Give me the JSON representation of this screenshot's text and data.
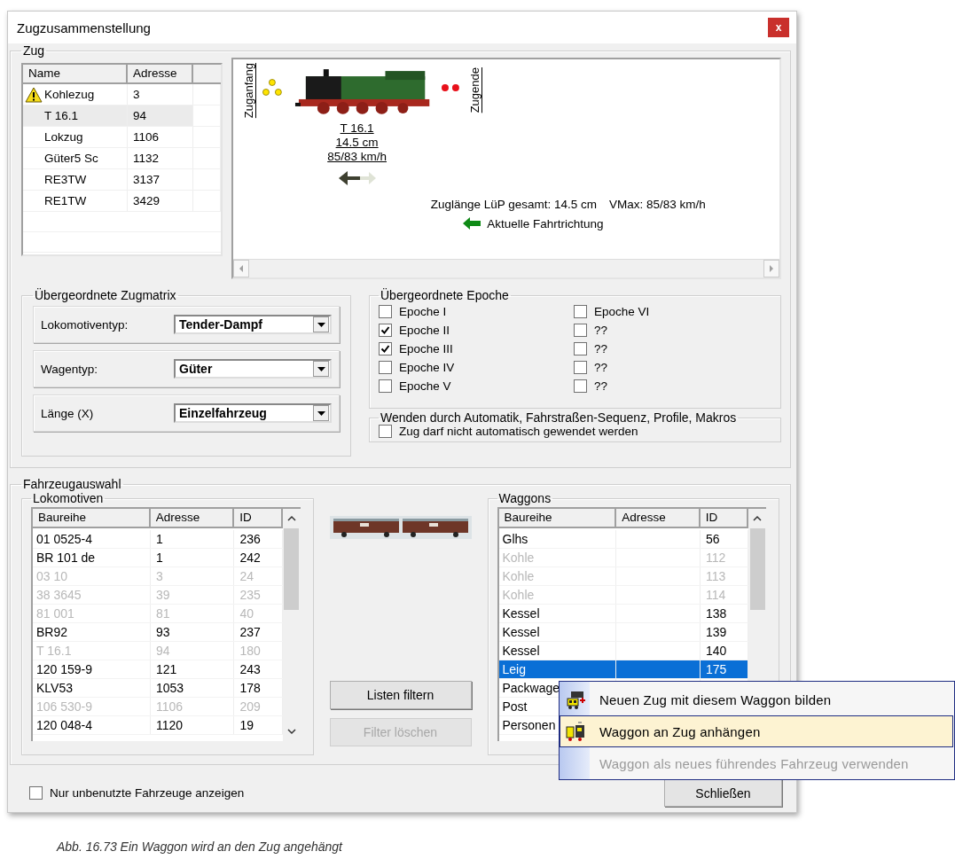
{
  "window": {
    "title": "Zugzusammenstellung",
    "close_label": "x"
  },
  "train": {
    "label": "Zug",
    "columns": [
      "Name",
      "Adresse"
    ],
    "rows": [
      {
        "name": "Kohlezug",
        "address": "3",
        "warning": true,
        "selected": false
      },
      {
        "name": "T 16.1",
        "address": "94",
        "warning": false,
        "selected": true
      },
      {
        "name": "Lokzug",
        "address": "1106",
        "warning": false,
        "selected": false
      },
      {
        "name": "Güter5 Sc",
        "address": "1132",
        "warning": false,
        "selected": false
      },
      {
        "name": "RE3TW",
        "address": "3137",
        "warning": false,
        "selected": false
      },
      {
        "name": "RE1TW",
        "address": "3429",
        "warning": false,
        "selected": false
      }
    ]
  },
  "preview": {
    "start_label": "Zuganfang",
    "end_label": "Zugende",
    "vehicle": {
      "name": "T 16.1",
      "length": "14.5 cm",
      "speed": "85/83 km/h"
    },
    "summary_length": "Zuglänge LüP gesamt: 14.5 cm",
    "summary_speed": "VMax: 85/83 km/h",
    "direction_label": "Aktuelle Fahrtrichtung"
  },
  "matrix": {
    "label": "Übergeordnete Zugmatrix",
    "fields": [
      {
        "label": "Lokomotiventyp:",
        "value": "Tender-Dampf"
      },
      {
        "label": "Wagentyp:",
        "value": "Güter"
      },
      {
        "label": "Länge (X)",
        "value": "Einzelfahrzeug"
      }
    ]
  },
  "epoch": {
    "label": "Übergeordnete Epoche",
    "options": [
      {
        "label": "Epoche I",
        "checked": false
      },
      {
        "label": "Epoche II",
        "checked": true
      },
      {
        "label": "Epoche III",
        "checked": true
      },
      {
        "label": "Epoche IV",
        "checked": false
      },
      {
        "label": "Epoche V",
        "checked": false
      },
      {
        "label": "Epoche VI",
        "checked": false
      },
      {
        "label": "??",
        "checked": false
      },
      {
        "label": "??",
        "checked": false
      },
      {
        "label": "??",
        "checked": false
      },
      {
        "label": "??",
        "checked": false
      }
    ]
  },
  "turning": {
    "label": "Wenden durch Automatik, Fahrstraßen-Sequenz, Profile, Makros",
    "option": {
      "label": "Zug darf nicht automatisch gewendet werden",
      "checked": false
    }
  },
  "vehicle_selection": {
    "label": "Fahrzeugauswahl",
    "locomotives": {
      "label": "Lokomotiven",
      "columns": [
        "Baureihe",
        "Adresse",
        "ID"
      ],
      "rows": [
        {
          "series": "01 0525-4",
          "address": "1",
          "id": "236",
          "disabled": false
        },
        {
          "series": "BR 101 de",
          "address": "1",
          "id": "242",
          "disabled": false
        },
        {
          "series": "03 10",
          "address": "3",
          "id": "24",
          "disabled": true
        },
        {
          "series": "38 3645",
          "address": "39",
          "id": "235",
          "disabled": true
        },
        {
          "series": "81 001",
          "address": "81",
          "id": "40",
          "disabled": true
        },
        {
          "series": "BR92",
          "address": "93",
          "id": "237",
          "disabled": false
        },
        {
          "series": "T 16.1",
          "address": "94",
          "id": "180",
          "disabled": true
        },
        {
          "series": "120 159-9",
          "address": "121",
          "id": "243",
          "disabled": false
        },
        {
          "series": "KLV53",
          "address": "1053",
          "id": "178",
          "disabled": false
        },
        {
          "series": "106 530-9",
          "address": "1106",
          "id": "209",
          "disabled": true
        },
        {
          "series": "120 048-4",
          "address": "1120",
          "id": "19",
          "disabled": false
        }
      ]
    },
    "buttons": [
      {
        "label": "Listen filtern",
        "disabled": false
      },
      {
        "label": "Filter löschen",
        "disabled": true
      }
    ],
    "waggons": {
      "label": "Waggons",
      "columns": [
        "Baureihe",
        "Adresse",
        "ID"
      ],
      "rows": [
        {
          "series": "Glhs",
          "id": "56",
          "disabled": false,
          "selected": false
        },
        {
          "series": "Kohle",
          "id": "112",
          "disabled": true,
          "selected": false
        },
        {
          "series": "Kohle",
          "id": "113",
          "disabled": true,
          "selected": false
        },
        {
          "series": "Kohle",
          "id": "114",
          "disabled": true,
          "selected": false
        },
        {
          "series": "Kessel",
          "id": "138",
          "disabled": false,
          "selected": false
        },
        {
          "series": "Kessel",
          "id": "139",
          "disabled": false,
          "selected": false
        },
        {
          "series": "Kessel",
          "id": "140",
          "disabled": false,
          "selected": false
        },
        {
          "series": "Leig",
          "id": "175",
          "disabled": false,
          "selected": true
        },
        {
          "series": "Packwage",
          "disabled": false,
          "selected": false
        },
        {
          "series": "Post",
          "disabled": false,
          "selected": false
        },
        {
          "series": "Personen",
          "disabled": false,
          "selected": false
        }
      ]
    }
  },
  "unused_only": {
    "label": "Nur unbenutzte Fahrzeuge anzeigen",
    "checked": false
  },
  "close_button": "Schließen",
  "context_menu": {
    "items": [
      {
        "label": "Neuen Zug mit diesem Waggon bilden",
        "selected": false,
        "disabled": false
      },
      {
        "label": "Waggon an Zug anhängen",
        "selected": true,
        "disabled": false
      },
      {
        "label": "Waggon als neues führendes Fahrzeug verwenden",
        "selected": false,
        "disabled": true
      }
    ]
  },
  "caption": "Abb. 16.73  Ein Waggon wird an den Zug angehängt"
}
